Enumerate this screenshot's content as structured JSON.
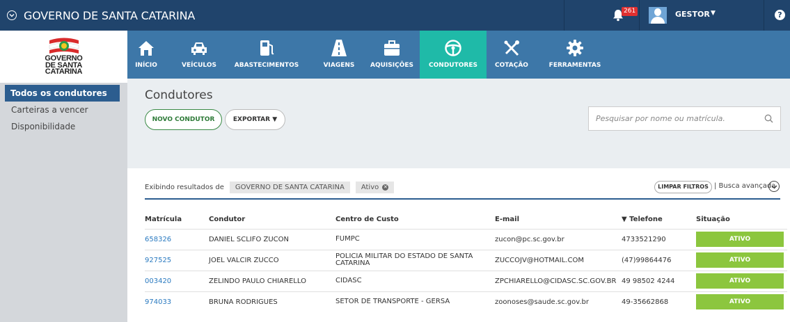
{
  "topbar": {
    "title": "GOVERNO DE SANTA CATARINA",
    "notifications": "261",
    "user": "GESTOR"
  },
  "logo": {
    "line1": "GOVERNO",
    "line2": "DE SANTA",
    "line3": "CATARINA"
  },
  "nav": [
    {
      "label": "INÍCIO",
      "icon": "home-icon"
    },
    {
      "label": "VEÍCULOS",
      "icon": "car-icon"
    },
    {
      "label": "ABASTECIMENTOS",
      "icon": "fuel-icon"
    },
    {
      "label": "VIAGENS",
      "icon": "road-icon"
    },
    {
      "label": "AQUISIÇÕES",
      "icon": "briefcase-icon"
    },
    {
      "label": "CONDUTORES",
      "icon": "steering-wheel-icon"
    },
    {
      "label": "COTAÇÃO",
      "icon": "tools-icon"
    },
    {
      "label": "FERRAMENTAS",
      "icon": "gear-icon"
    }
  ],
  "sidebar": [
    {
      "label": "Todos os condutores"
    },
    {
      "label": "Carteiras a vencer"
    },
    {
      "label": "Disponibilidade"
    }
  ],
  "page": {
    "title": "Condutores",
    "new_button": "NOVO CONDUTOR",
    "export_button": "EXPORTAR ▼",
    "search_placeholder": "Pesquisar por nome ou matrícula."
  },
  "filters": {
    "prefix": "Exibindo resultados de",
    "chip1": "GOVERNO DE SANTA CATARINA",
    "chip2": "Ativo",
    "clear": "LIMPAR FILTROS",
    "advanced": "| Busca avançada"
  },
  "table": {
    "headers": [
      "Matrícula",
      "Condutor",
      "Centro de Custo",
      "E-mail",
      "▼ Telefone",
      "Situação"
    ],
    "rows": [
      [
        "658326",
        "DANIEL SCLIFO ZUCON",
        "FUMPC",
        "zucon@pc.sc.gov.br",
        "4733521290",
        "ATIVO"
      ],
      [
        "927525",
        "JOEL VALCIR ZUCCO",
        "POLICIA MILITAR DO ESTADO DE SANTA CATARINA",
        "ZUCCOJV@HOTMAIL.COM",
        "(47)99864476",
        "ATIVO"
      ],
      [
        "003420",
        "ZELINDO PAULO CHIARELLO",
        "CIDASC",
        "ZPCHIARELLO@CIDASC.SC.GOV.BR",
        "49 98502 4244",
        "ATIVO"
      ],
      [
        "974033",
        "BRUNA RODRIGUES",
        "SETOR DE TRANSPORTE - GERSA",
        "zoonoses@saude.sc.gov.br",
        "49-35662868",
        "ATIVO"
      ]
    ]
  },
  "colors": {
    "topbar": "#20446c",
    "nav": "#3d77a8",
    "nav_active": "#1fbaa8",
    "status": "#8cc63e"
  }
}
